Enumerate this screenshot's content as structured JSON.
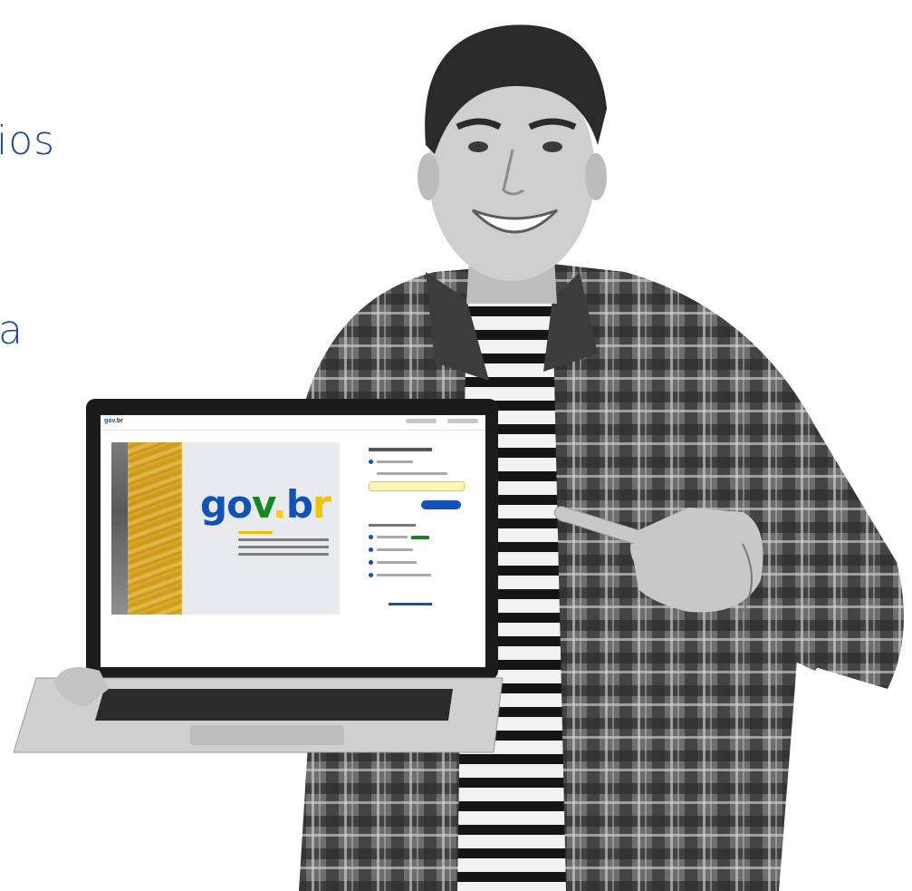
{
  "heading": {
    "fragment_1": "ios",
    "fragment_2": "a"
  },
  "laptop_screen": {
    "header_logo": "gov",
    "header_logo_suffix": "br",
    "hero_logo_parts": [
      "g",
      "o",
      "v",
      ".",
      "b",
      "r"
    ]
  },
  "colors": {
    "heading_blue": "#1f4b8e",
    "govbr_blue": "#1351b4",
    "govbr_green": "#168821",
    "govbr_yellow": "#ffcd07",
    "field_highlight": "#fff6b5"
  }
}
